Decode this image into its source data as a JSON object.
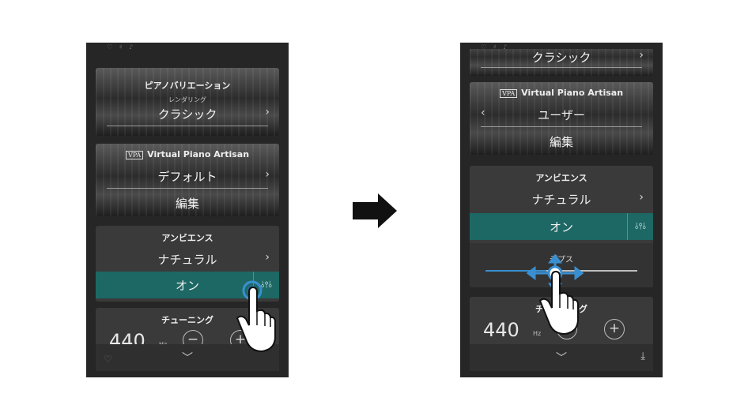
{
  "left_screen": {
    "status_icons": "♡ ♯ ♪",
    "piano_variation": {
      "title": "ピアノバリエーション",
      "subtitle": "レンダリング",
      "value": "クラシック",
      "arrow": "›"
    },
    "vpa": {
      "badge": "VPA",
      "title": "Virtual Piano Artisan",
      "value": "デフォルト",
      "arrow": "›",
      "edit": "編集"
    },
    "ambience": {
      "title": "アンビエンス",
      "value": "ナチュラル",
      "arrow": "›",
      "toggle": "オン",
      "settings_glyph": "⫰⫯⫰"
    },
    "tuning": {
      "title": "チューニング",
      "value": "440",
      "unit": "Hz",
      "minus": "−",
      "plus": "+"
    },
    "bottom": {
      "chevron": "﹀",
      "favorite_glyph": "♡"
    }
  },
  "right_screen": {
    "status_icons": "♡ ♯ ♪",
    "piano_variation": {
      "value": "クラシック",
      "arrow": "›"
    },
    "vpa": {
      "badge": "VPA",
      "title": "Virtual Piano Artisan",
      "back_arrow": "‹",
      "value": "ユーザー",
      "edit": "編集"
    },
    "ambience": {
      "title": "アンビエンス",
      "value": "ナチュラル",
      "arrow": "›",
      "toggle": "オン",
      "settings_glyph": "⫰⫯⫰",
      "depth_label": "デプス",
      "depth_level": 0.4
    },
    "tuning": {
      "title": "チューニング",
      "value": "440",
      "unit": "Hz",
      "minus": "−",
      "plus": "+"
    },
    "bottom": {
      "chevron": "﹀",
      "download_glyph": "⤓"
    }
  },
  "colors": {
    "accent_teal": "#1d6865",
    "gesture_blue": "#3a8fd0",
    "panel": "#3a3a3a",
    "background": "#262626"
  }
}
